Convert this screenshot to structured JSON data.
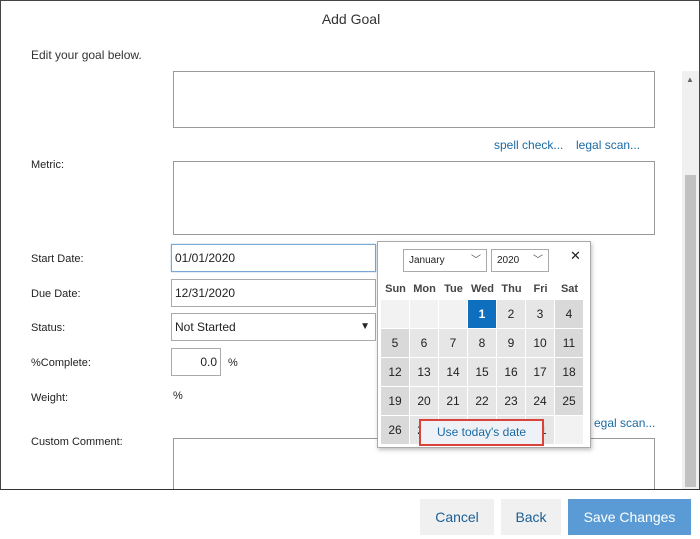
{
  "dialog": {
    "title": "Add Goal",
    "subtitle": "Edit your goal below."
  },
  "links": {
    "spell_check": "spell check...",
    "legal_scan": "legal scan...",
    "legal_scan_partial": "egal scan..."
  },
  "form": {
    "metric_label": "Metric:",
    "start_date_label": "Start Date:",
    "start_date_value": "01/01/2020",
    "due_date_label": "Due Date:",
    "due_date_value": "12/31/2020",
    "status_label": "Status:",
    "status_value": "Not Started",
    "complete_label": "%Complete:",
    "complete_value": "0.0",
    "percent_sign": "%",
    "weight_label": "Weight:",
    "weight_value": "%",
    "custom_comment_label": "Custom Comment:"
  },
  "datepicker": {
    "month": "January",
    "year": "2020",
    "close_glyph": "✕",
    "weekdays": [
      "Sun",
      "Mon",
      "Tue",
      "Wed",
      "Thu",
      "Fri",
      "Sat"
    ],
    "today_button": "Use today's date",
    "selected_day": "1"
  },
  "footer": {
    "cancel": "Cancel",
    "back": "Back",
    "save": "Save Changes"
  }
}
